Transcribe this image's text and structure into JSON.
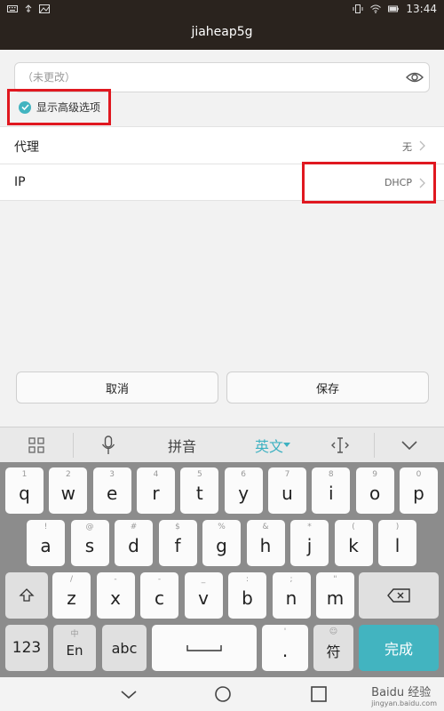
{
  "status_bar": {
    "time": "13:44"
  },
  "header": {
    "title": "jiaheap5g"
  },
  "password": {
    "placeholder": "（未更改）"
  },
  "advanced": {
    "label": "显示高级选项",
    "checked": true
  },
  "rows": {
    "proxy": {
      "label": "代理",
      "value": "无"
    },
    "ip": {
      "label": "IP",
      "value": "DHCP"
    }
  },
  "buttons": {
    "cancel": "取消",
    "save": "保存"
  },
  "ime_bar": {
    "pinyin": "拼音",
    "english": "英文",
    "accent_color": "#3db1c1"
  },
  "keyboard": {
    "row1": [
      {
        "main": "q",
        "hint": "1"
      },
      {
        "main": "w",
        "hint": "2"
      },
      {
        "main": "e",
        "hint": "3"
      },
      {
        "main": "r",
        "hint": "4"
      },
      {
        "main": "t",
        "hint": "5"
      },
      {
        "main": "y",
        "hint": "6"
      },
      {
        "main": "u",
        "hint": "7"
      },
      {
        "main": "i",
        "hint": "8"
      },
      {
        "main": "o",
        "hint": "9"
      },
      {
        "main": "p",
        "hint": "0"
      }
    ],
    "row2": [
      {
        "main": "a",
        "hint": "!"
      },
      {
        "main": "s",
        "hint": "@"
      },
      {
        "main": "d",
        "hint": "#"
      },
      {
        "main": "f",
        "hint": "$"
      },
      {
        "main": "g",
        "hint": "%"
      },
      {
        "main": "h",
        "hint": "&"
      },
      {
        "main": "j",
        "hint": "*"
      },
      {
        "main": "k",
        "hint": "("
      },
      {
        "main": "l",
        "hint": ")"
      }
    ],
    "row3": [
      {
        "main": "z",
        "hint": "/"
      },
      {
        "main": "x",
        "hint": "-"
      },
      {
        "main": "c",
        "hint": "-"
      },
      {
        "main": "v",
        "hint": "_"
      },
      {
        "main": "b",
        "hint": ":"
      },
      {
        "main": "n",
        "hint": ";"
      },
      {
        "main": "m",
        "hint": "\""
      }
    ],
    "num_key": "123",
    "lang_key": {
      "main": "En",
      "hint": "中"
    },
    "abc_key": "abc",
    "period_key": {
      "main": ".",
      "hint": "'"
    },
    "symbol_key": {
      "main": "符",
      "hint": "☺"
    },
    "done_key": "完成",
    "done_color": "#42b4c0"
  },
  "watermark": {
    "brand": "Baidu 经验",
    "url": "jingyan.baidu.com"
  },
  "highlight_color": "#e01820"
}
